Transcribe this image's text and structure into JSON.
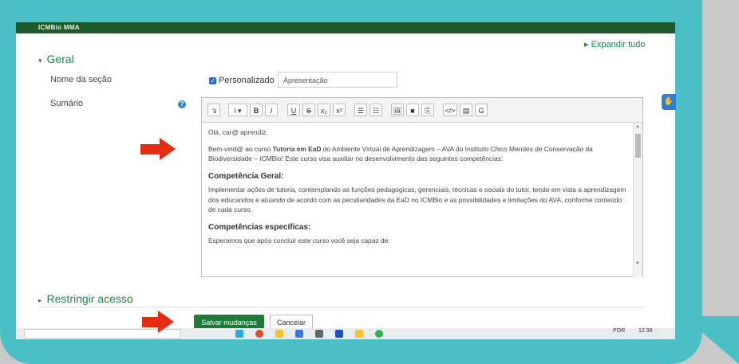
{
  "header": {
    "logo": "ICMBio MMA"
  },
  "expand_all": "Expandir tudo",
  "general": {
    "title": "Geral",
    "section_name_label": "Nome da seção",
    "summary_label": "Sumário",
    "custom_checkbox_label": "Personalizado",
    "section_name_value": "Apresentação"
  },
  "editor": {
    "toolbar": [
      "↴",
      "i ▾",
      "B",
      "I",
      "U",
      "S",
      "x₂",
      "x²",
      "☰",
      "☷",
      "🖼",
      "■",
      "⎘",
      "</>",
      "▤",
      "G"
    ],
    "greeting": "Olá, car@ aprendiz,",
    "welcome_prefix": "Bem-vind@ ao curso ",
    "welcome_bold": "Tutoria em EaD",
    "welcome_suffix": " do Ambiente Virtual de Aprendizagem – AVA do Instituto Chico Mendes de Conservação da Biodiversidade – ICMBio! Este curso visa auxiliar no desenvolvimento das seguintes competências:",
    "general_competence_title": "Competência Geral:",
    "general_competence_text": "Implementar ações de tutoria, contemplando as funções pedagógicas, gerenciais, técnicas e sociais do tutor, tendo em vista a aprendizagem dos educandos e atuando de acordo com as peculiaridades da EaD no ICMBio e as possibilidades e limitações do AVA, conforme conteúdo de cada curso.",
    "specific_competences_title": "Competências específicas:",
    "specific_competences_text": "Esperamos que após concluir este curso você seja capaz de:"
  },
  "restrict_access": "Restringir acesso",
  "buttons": {
    "save": "Salvar mudanças",
    "cancel": "Cancelar"
  },
  "taskbar": {
    "lang": "POR",
    "time": "12:39"
  },
  "colors": {
    "bubble": "#4bbfc6",
    "accent_green": "#1e8a4c",
    "save_button": "#1f7a3a",
    "arrow": "#e32b12"
  }
}
